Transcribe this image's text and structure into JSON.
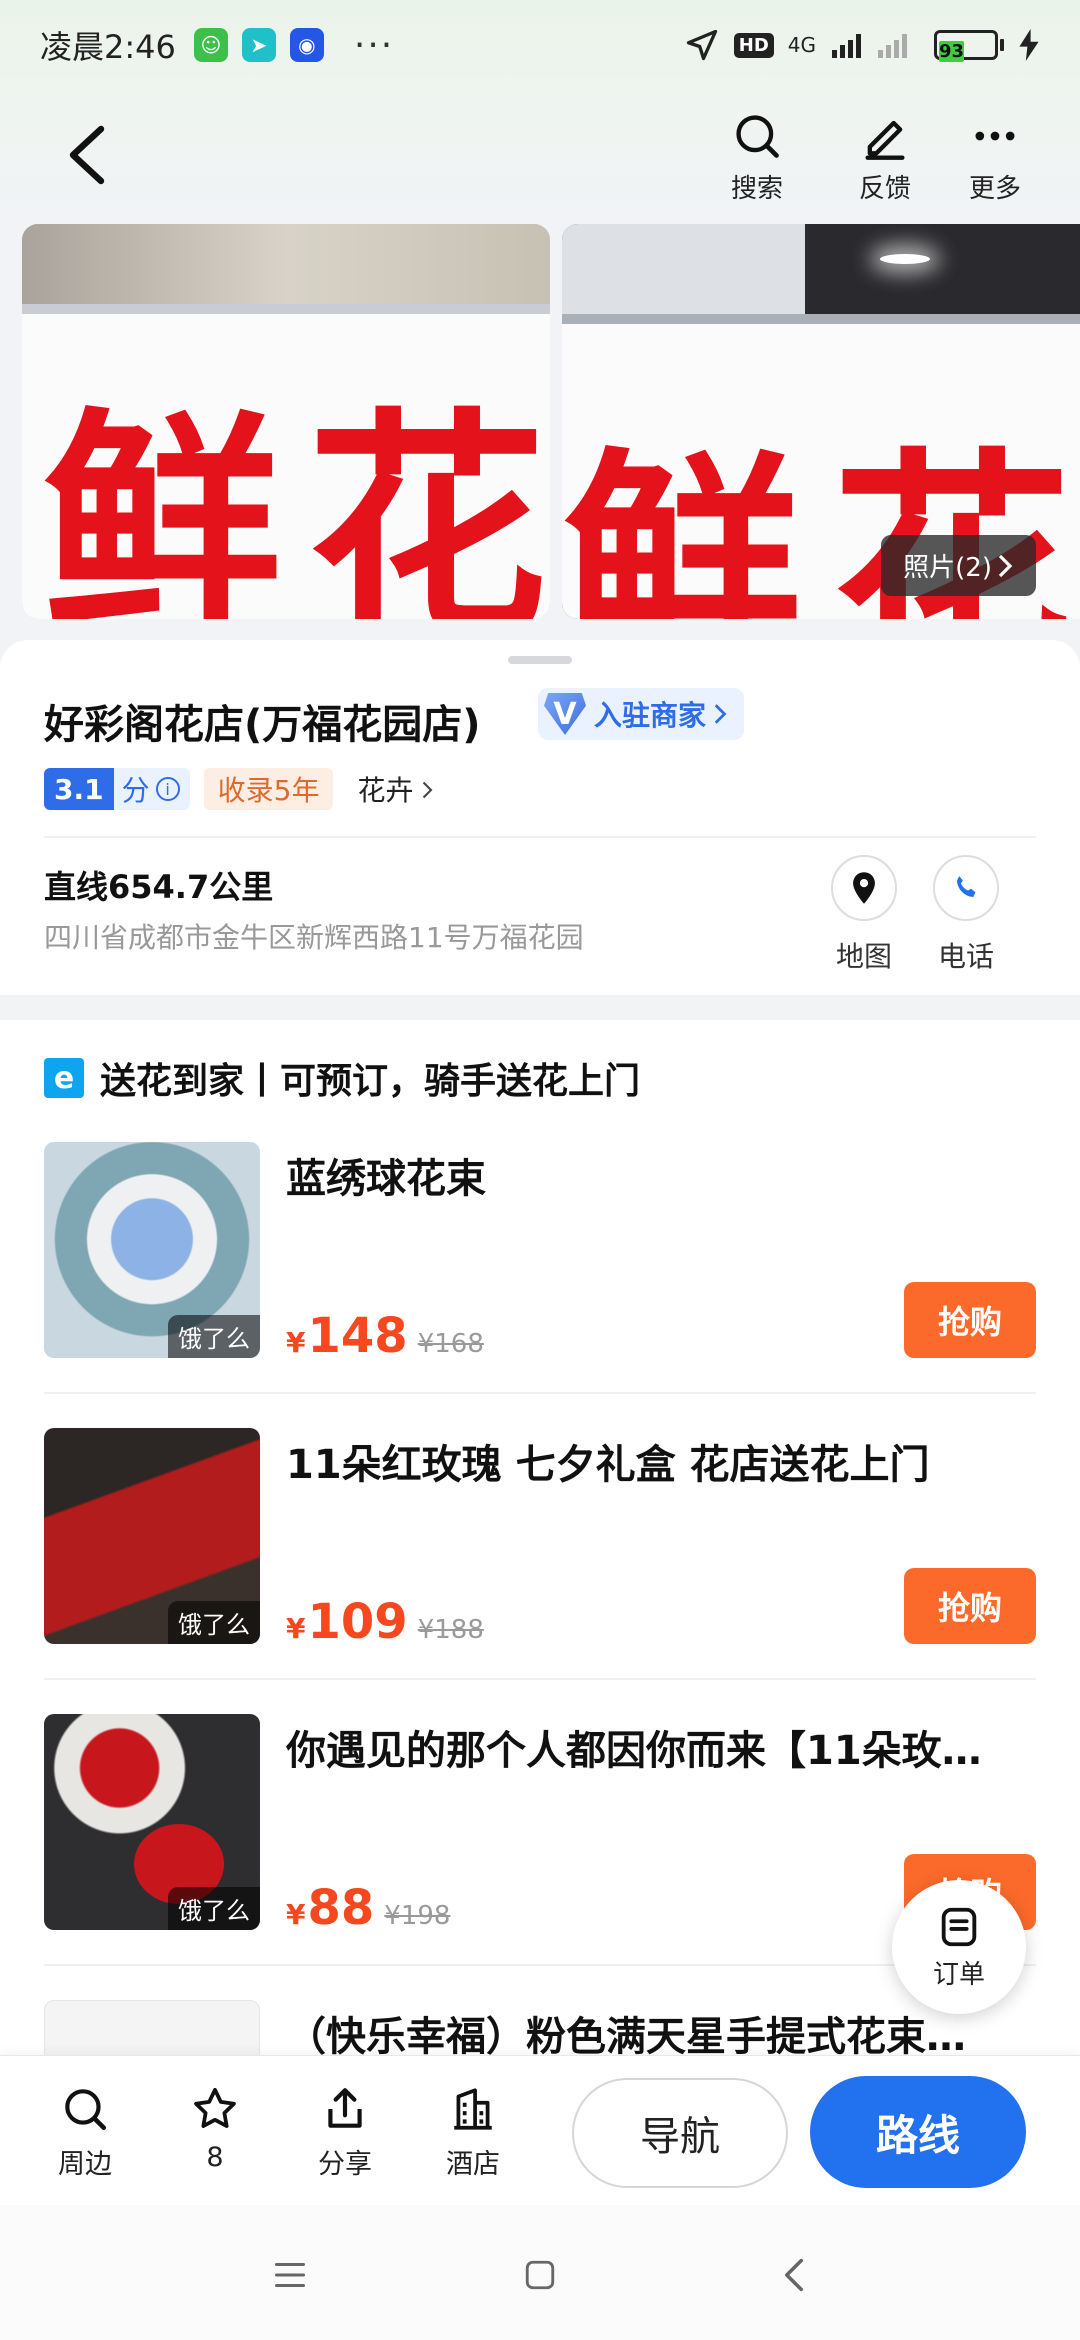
{
  "status_bar": {
    "time": "凌晨2:46",
    "dots": "···",
    "hd": "HD",
    "network": "4G",
    "battery": "93",
    "icons": [
      "wechat-app-icon",
      "location-app-icon",
      "calendar-app-icon",
      "navigation-arrow-icon",
      "signal-icon",
      "charging-icon"
    ]
  },
  "top_nav": {
    "search_label": "搜索",
    "feedback_label": "反馈",
    "more_label": "更多"
  },
  "photos": {
    "count_label": "照片(2)",
    "sign_chars": [
      "鲜",
      "花",
      "鲜",
      "花"
    ]
  },
  "shop": {
    "name": "好彩阁花店(万福花园店)",
    "merchant_badge": "入驻商家",
    "score": "3.1",
    "score_unit": "分",
    "years": "收录5年",
    "category": "花卉",
    "distance": "直线654.7公里",
    "address": "四川省成都市金牛区新辉西路11号万福花园",
    "map_label": "地图",
    "phone_label": "电话"
  },
  "delivery": {
    "title": "送花到家丨可预订，骑手送花上门",
    "items": [
      {
        "title": "蓝绣球花束",
        "currency": "¥",
        "price": "148",
        "original": "¥168",
        "tag": "饿了么",
        "buy": "抢购"
      },
      {
        "title": "11朵红玫瑰 七夕礼盒 花店送花上门",
        "currency": "¥",
        "price": "109",
        "original": "¥188",
        "tag": "饿了么",
        "buy": "抢购"
      },
      {
        "title": "你遇见的那个人都因你而来【11朵玫…",
        "currency": "¥",
        "price": "88",
        "original": "¥198",
        "tag": "饿了么",
        "buy": "抢购"
      },
      {
        "title": "（快乐幸福）粉色满天星手提式花束…",
        "currency": "¥",
        "price": "",
        "original": "",
        "tag": "",
        "buy": ""
      }
    ]
  },
  "order_button": {
    "label": "订单"
  },
  "toolbar": {
    "nearby": "周边",
    "favorites": "8",
    "share": "分享",
    "hotel": "酒店",
    "navigate": "导航",
    "route": "路线"
  },
  "colors": {
    "accent_blue": "#2271ee",
    "price_orange": "#f5481f",
    "buy_orange": "#fb6a2a"
  }
}
